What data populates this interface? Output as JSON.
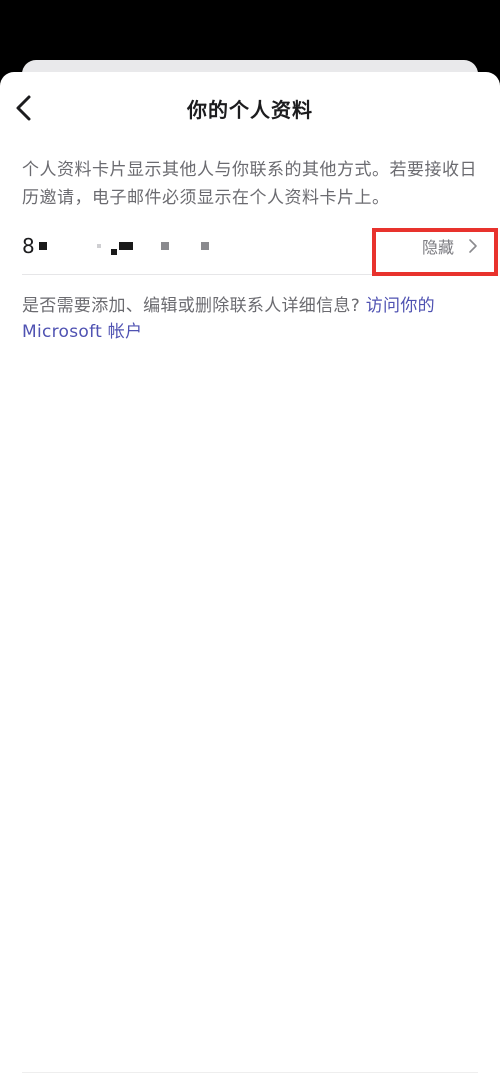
{
  "header": {
    "title": "你的个人资料"
  },
  "intro": {
    "text": "个人资料卡片显示其他人与你联系的其他方式。若要接收日历邀请，电子邮件必须显示在个人资料卡片上。"
  },
  "contact": {
    "value_prefix": "8",
    "visibility_label": "隐藏"
  },
  "help": {
    "text": "是否需要添加、编辑或删除联系人详细信息? ",
    "link_text": "访问你的 Microsoft 帐户"
  },
  "colors": {
    "link": "#4f52b2",
    "highlight": "#e8322d",
    "background": "#000000"
  }
}
